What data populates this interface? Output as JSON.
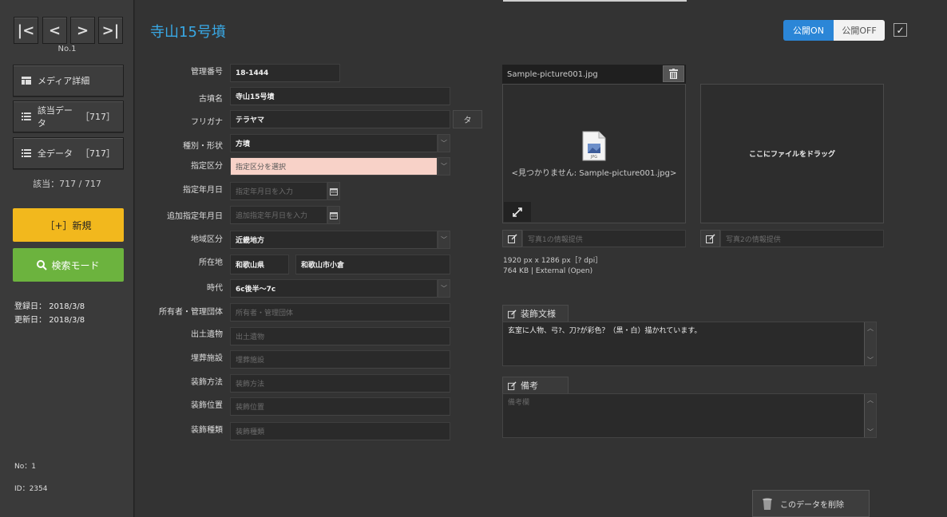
{
  "nav": {
    "first": "|<",
    "prev": "<",
    "next": ">",
    "last": ">|",
    "record_no": "No.1"
  },
  "sidebar": {
    "media_detail": "メディア詳細",
    "matched_data": "該当データ",
    "matched_count": "［717］",
    "all_data": "全データ",
    "all_count": "［717］",
    "count_line": "該当：717 / 717",
    "new_button": "［+］新規",
    "search_button": "検索モード",
    "registered_label": "登録日：",
    "registered": "2018/3/8",
    "updated_label": "更新日：",
    "updated": "2018/3/8",
    "no_line": "No：1",
    "id_line": "ID：2354"
  },
  "header": {
    "title": "寺山15号墳",
    "public_on": "公開ON",
    "public_off": "公開OFF",
    "public_state": "on"
  },
  "form": {
    "management_no": {
      "label": "管理番号",
      "value": "18-1444"
    },
    "tumulus_name": {
      "label": "古墳名",
      "value": "寺山15号墳"
    },
    "furigana": {
      "label": "フリガナ",
      "value": "テラヤマ",
      "button": "タ"
    },
    "type_shape": {
      "label": "種別・形状",
      "value": "方墳"
    },
    "designation": {
      "label": "指定区分",
      "placeholder": "指定区分を選択"
    },
    "designation_date": {
      "label": "指定年月日",
      "placeholder": "指定年月日を入力"
    },
    "additional_date": {
      "label": "追加指定年月日",
      "placeholder": "追加指定年月日を入力"
    },
    "region": {
      "label": "地域区分",
      "value": "近畿地方"
    },
    "location": {
      "label": "所在地",
      "prefecture": "和歌山県",
      "city": "和歌山市小倉"
    },
    "era": {
      "label": "時代",
      "value": "6c後半〜7c"
    },
    "owner": {
      "label": "所有者・管理団体",
      "placeholder": "所有者・管理団体"
    },
    "excavated": {
      "label": "出土遺物",
      "placeholder": "出土遺物"
    },
    "burial": {
      "label": "埋葬施設",
      "placeholder": "埋葬施設"
    },
    "deco_method": {
      "label": "装飾方法",
      "placeholder": "装飾方法"
    },
    "deco_position": {
      "label": "装飾位置",
      "placeholder": "装飾位置"
    },
    "deco_type": {
      "label": "装飾種類",
      "placeholder": "装飾種類"
    }
  },
  "media": {
    "filename": "Sample-picture001.jpg",
    "not_found": "<見つかりません: Sample-picture001.jpg>",
    "drop_hint": "ここにファイルをドラッグ",
    "photo1_placeholder": "写真1の情報提供",
    "photo2_placeholder": "写真2の情報提供",
    "dimensions": "1920 px  x 1286 px［? dpi］",
    "size_info": "764 KB | External (Open)"
  },
  "decoration": {
    "label": "装飾文様",
    "text": "玄室に人物、弓?、刀?が彩色？（黒・白）描かれています。"
  },
  "remarks": {
    "label": "備考",
    "placeholder": "備考欄"
  },
  "delete_button": "このデータを削除",
  "colors": {
    "title": "#39a9e6",
    "new_button": "#f2b81d",
    "search_button": "#6cb33e",
    "public_on": "#2b86d7",
    "designation_field": "#f8d2c8"
  }
}
